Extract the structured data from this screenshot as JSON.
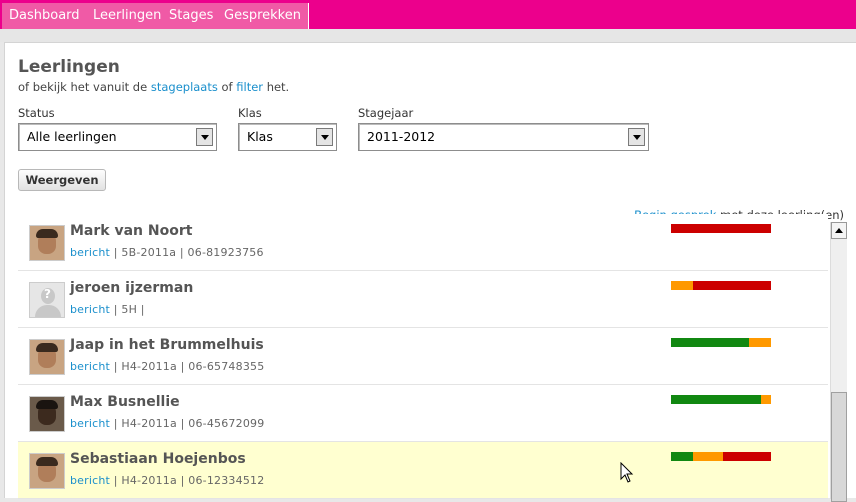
{
  "nav": {
    "tabs": [
      "Dashboard",
      "Leerlingen",
      "Stages",
      "Gesprekken"
    ]
  },
  "header": {
    "title": "Leerlingen",
    "subtitle_prefix": "of bekijk het vanuit de",
    "link_stageplaats": "stageplaats",
    "subtitle_mid": "of",
    "link_filter": "filter",
    "subtitle_suffix": "het."
  },
  "filters": {
    "status_label": "Status",
    "status_value": "Alle leerlingen",
    "klas_label": "Klas",
    "klas_value": "Klas",
    "stagejaar_label": "Stagejaar",
    "stagejaar_value": "2011-2012",
    "submit_label": "Weergeven"
  },
  "list_header": {
    "link": "Begin gesprek",
    "text": "met deze leerling(en)"
  },
  "students": [
    {
      "name": "Mark van Noort",
      "link": "bericht",
      "class": "5B-2011a",
      "phone": "06-81923756",
      "bar": [
        {
          "color": "#cc0000",
          "fraction": 1.0
        }
      ]
    },
    {
      "name": "jeroen ijzerman",
      "link": "bericht",
      "class": "5H",
      "phone": "",
      "bar": [
        {
          "color": "#ff9900",
          "fraction": 0.22
        },
        {
          "color": "#cc0000",
          "fraction": 0.78
        }
      ]
    },
    {
      "name": "Jaap in het Brummelhuis",
      "link": "bericht",
      "class": "H4-2011a",
      "phone": "06-65748355",
      "bar": [
        {
          "color": "#118811",
          "fraction": 0.78
        },
        {
          "color": "#ff9900",
          "fraction": 0.22
        }
      ]
    },
    {
      "name": "Max Busnellie",
      "link": "bericht",
      "class": "H4-2011a",
      "phone": "06-45672099",
      "bar": [
        {
          "color": "#118811",
          "fraction": 0.9
        },
        {
          "color": "#ff9900",
          "fraction": 0.1
        }
      ]
    },
    {
      "name": "Sebastiaan Hoejenbos",
      "link": "bericht",
      "class": "H4-2011a",
      "phone": "06-12334512",
      "bar": [
        {
          "color": "#118811",
          "fraction": 0.22
        },
        {
          "color": "#ff9900",
          "fraction": 0.3
        },
        {
          "color": "#cc0000",
          "fraction": 0.48
        }
      ]
    }
  ]
}
